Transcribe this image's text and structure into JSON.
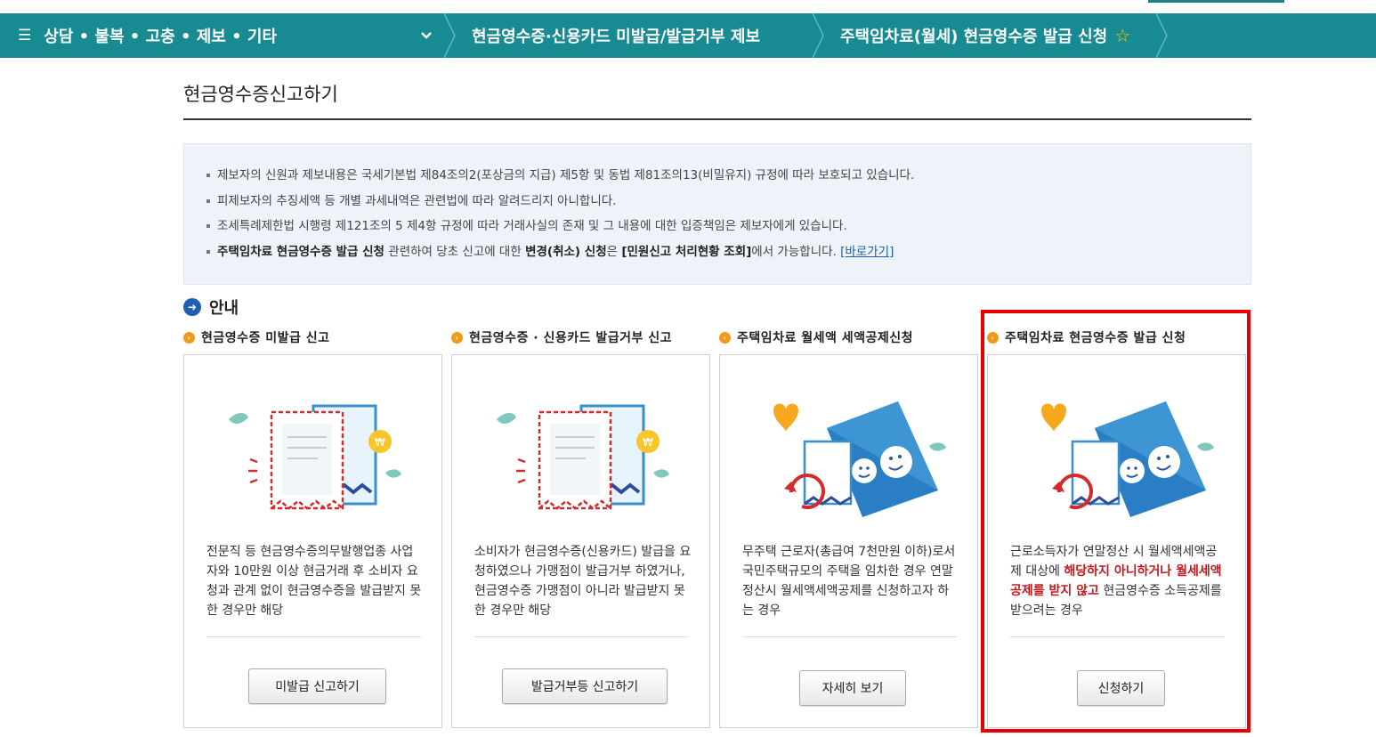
{
  "navbar": {
    "menu_label": "상담 • 불복 • 고충 • 제보 • 기타",
    "breadcrumbs": [
      "현금영수증·신용카드 미발급/발급거부 제보",
      "주택임차료(월세) 현금영수증 발급 신청"
    ],
    "favorite_icon": "star-icon"
  },
  "page_title": "현금영수증신고하기",
  "notice": {
    "items": [
      "제보자의 신원과 제보내용은 국세기본법 제84조의2(포상금의 지급) 제5항 및 동법 제81조의13(비밀유지) 규정에 따라 보호되고 있습니다.",
      "피제보자의 추징세액 등 개별 과세내역은 관련법에 따라 알려드리지 아니합니다.",
      "조세특례제한법 시행령 제121조의 5 제4항 규정에 따라 거래사실의 존재 및 그 내용에 대한 입증책임은 제보자에게 있습니다."
    ],
    "last": {
      "bold1": "주택임차료 현금영수증 발급 신청",
      "text1": " 관련하여 당초 신고에 대한 ",
      "bold2": "변경(취소) 신청",
      "text2": "은 ",
      "bold3": "[민원신고 처리현황 조회]",
      "text3": "에서 가능합니다. ",
      "link": "[바로가기]"
    }
  },
  "guide_label": "안내",
  "cards": [
    {
      "title": "현금영수증 미발급 신고",
      "desc": "전문직 등 현금영수증의무발행업종 사업자와 10만원 이상 현금거래 후 소비자 요청과 관계 없이 현금영수증을 발급받지 못한 경우만 해당",
      "button": "미발급 신고하기"
    },
    {
      "title": "현금영수증 · 신용카드 발급거부 신고",
      "desc": "소비자가 현금영수증(신용카드) 발급을 요청하였으나 가맹점이 발급거부 하였거나, 현금영수증 가맹점이 아니라 발급받지 못한 경우만 해당",
      "button": "발급거부등 신고하기"
    },
    {
      "title": "주택임차료 월세액 세액공제신청",
      "desc": "무주택 근로자(총급여 7천만원 이하)로서 국민주택규모의 주택을 임차한 경우 연말정산시 월세액세액공제를 신청하고자 하는 경우",
      "button": "자세히 보기"
    },
    {
      "title": "주택임차료 현금영수증 발급 신청",
      "desc_pre": "근로소득자가 연말정산 시 월세액세액공제 대상에 ",
      "desc_red": "해당하지 아니하거나 월세세액공제를 받지 않고",
      "desc_post": " 현금영수증 소득공제를 받으려는 경우",
      "button": "신청하기"
    }
  ],
  "colors": {
    "navbar": "#188a92",
    "highlight": "#e60000",
    "accent_red": "#c4191f",
    "bullet_orange": "#f19a1a",
    "guide_blue": "#1f5fb0"
  }
}
